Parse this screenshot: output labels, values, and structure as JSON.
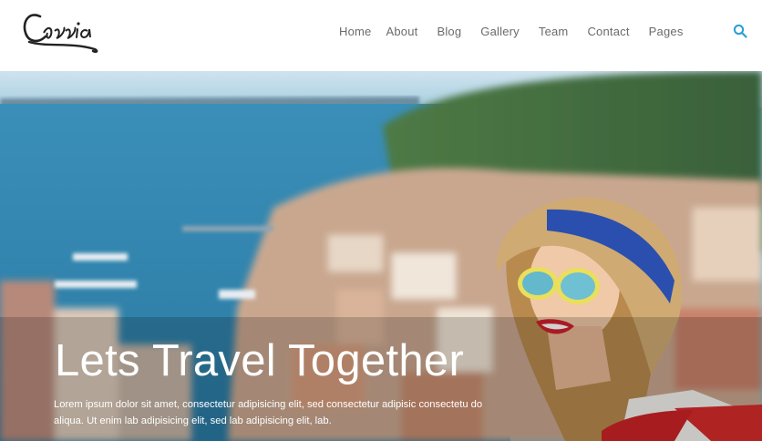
{
  "brand": {
    "logo_text": "Cassia"
  },
  "nav": {
    "items": [
      "Home",
      "About",
      "Blog",
      "Gallery",
      "Team",
      "Contact",
      "Pages"
    ]
  },
  "search": {
    "icon": "search-icon",
    "color": "#2a9fd6"
  },
  "hero": {
    "headline": "Lets Travel Together",
    "subtext": "Lorem ipsum dolor sit amet, consectetur adipisicing elit, sed consectetur adipisic consectetu do aliqua. Ut enim lab adipisicing elit, sed lab adipisicing elit, lab."
  }
}
